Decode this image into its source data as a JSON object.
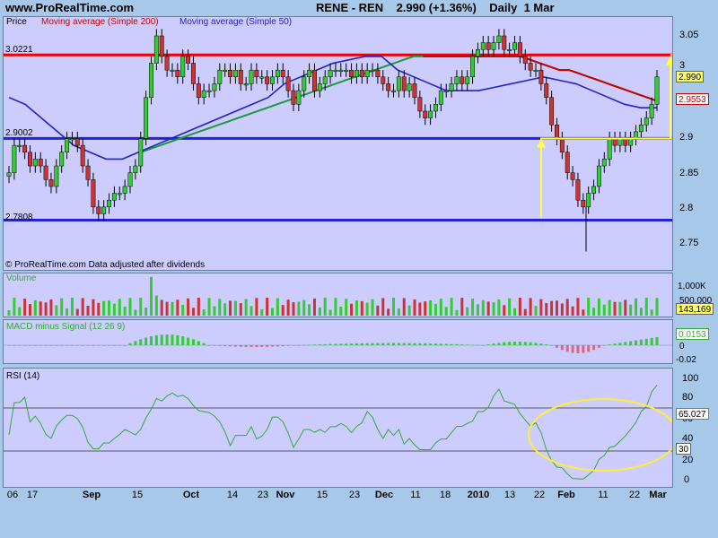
{
  "header": {
    "site": "www.ProRealTime.com",
    "ticker": "RENE - REN    2.990 (+1.36%)    Daily  1 Mar"
  },
  "price_panel": {
    "label_price": "Price",
    "label_ma200": "Moving average (Simple 200)",
    "label_ma50": "Moving average (Simple 50)",
    "footer": "© ProRealTime.com  Data adjusted after dividends",
    "level_labels": [
      "3.0221",
      "2.9002",
      "2.7808"
    ],
    "y_ticks": [
      "3.05",
      "3",
      "2.9",
      "2.85",
      "2.8",
      "2.75"
    ],
    "last_price": "2.990",
    "ma200_value": "2.9553"
  },
  "volume_panel": {
    "label": "Volume",
    "y_ticks": [
      "1,000K",
      "500,000"
    ],
    "last_value": "143,169"
  },
  "macd_panel": {
    "label": "MACD minus Signal (12 26 9)",
    "y_ticks": [
      "0",
      "-0.02"
    ],
    "last_value": "0.0153"
  },
  "rsi_panel": {
    "label": "RSI (14)",
    "y_ticks": [
      "100",
      "80",
      "60",
      "40",
      "20",
      "0"
    ],
    "last_value": "65.027",
    "lower_band_value": "30"
  },
  "x_axis": [
    "06",
    "17",
    "Sep",
    "15",
    "Oct",
    "14",
    "23",
    "Nov",
    "15",
    "23",
    "Dec",
    "11",
    "18",
    "2010",
    "13",
    "22",
    "Feb",
    "11",
    "22",
    "Mar"
  ],
  "colors": {
    "background": "#a8c8ea",
    "panel": "#ccccff",
    "up_candle": "#33cc33",
    "down_candle": "#cc3333",
    "ma200": "#cc0000",
    "ma50": "#2222cc",
    "resistance": "#ee0000",
    "support": "#2222dd",
    "annotation": "#ffff44"
  },
  "chart_data": {
    "type": "candlestick",
    "title": "RENE - REN 2.990 (+1.36%) Daily 1 Mar",
    "ylabel": "Price",
    "ylim": [
      2.71,
      3.07
    ],
    "horizontal_levels": [
      3.0221,
      2.9002,
      2.7808
    ],
    "last_close": 2.99,
    "ma200_last": 2.9553,
    "close": [
      2.85,
      2.89,
      2.89,
      2.88,
      2.86,
      2.87,
      2.86,
      2.84,
      2.83,
      2.86,
      2.88,
      2.9,
      2.9,
      2.89,
      2.86,
      2.84,
      2.8,
      2.79,
      2.8,
      2.81,
      2.82,
      2.82,
      2.83,
      2.85,
      2.86,
      2.9,
      2.96,
      3.01,
      3.05,
      3.02,
      3.0,
      3.0,
      2.99,
      3.02,
      3.01,
      2.98,
      2.96,
      2.97,
      2.97,
      2.98,
      3.0,
      3.0,
      2.99,
      3.0,
      2.98,
      2.98,
      3.0,
      2.99,
      2.99,
      2.98,
      2.99,
      3.0,
      2.99,
      2.97,
      2.95,
      2.97,
      2.99,
      3.0,
      2.97,
      2.98,
      2.99,
      3.0,
      3.0,
      3.0,
      3.0,
      2.99,
      3.0,
      2.99,
      3.0,
      3.0,
      2.99,
      2.98,
      2.97,
      2.97,
      2.99,
      2.97,
      2.98,
      2.96,
      2.94,
      2.93,
      2.94,
      2.95,
      2.97,
      2.97,
      2.98,
      2.99,
      2.98,
      2.99,
      3.02,
      3.03,
      3.04,
      3.03,
      3.04,
      3.05,
      3.03,
      3.03,
      3.04,
      3.02,
      3.01,
      3.0,
      3.0,
      2.98,
      2.96,
      2.92,
      2.9,
      2.88,
      2.85,
      2.84,
      2.81,
      2.8,
      2.82,
      2.83,
      2.86,
      2.87,
      2.9,
      2.89,
      2.9,
      2.89,
      2.9,
      2.91,
      2.92,
      2.93,
      2.95,
      2.99
    ],
    "ma200": [
      2.88,
      2.885,
      2.89,
      2.895,
      2.9,
      2.905,
      2.91,
      2.915,
      2.92,
      2.925,
      2.93,
      2.935,
      2.94,
      2.945,
      2.95,
      2.955,
      2.96,
      2.965,
      2.97,
      2.975,
      2.98,
      2.985,
      2.99,
      2.995,
      3.0,
      3.005,
      3.01,
      3.015,
      3.02,
      3.02,
      3.02,
      3.02,
      3.02,
      3.02,
      3.02,
      3.02,
      3.02,
      3.02,
      3.02,
      3.02,
      3.015,
      3.01,
      3.005,
      3.0,
      3.0,
      2.995,
      2.99,
      2.985,
      2.98,
      2.975,
      2.97,
      2.965,
      2.96,
      2.955
    ],
    "ma50": [
      2.96,
      2.95,
      2.93,
      2.91,
      2.89,
      2.88,
      2.87,
      2.87,
      2.88,
      2.89,
      2.9,
      2.91,
      2.92,
      2.93,
      2.94,
      2.95,
      2.96,
      2.98,
      2.99,
      3.0,
      3.01,
      3.015,
      3.02,
      3.02,
      3.0,
      2.99,
      2.98,
      2.97,
      2.97,
      2.97,
      2.975,
      2.98,
      2.985,
      2.99,
      2.985,
      2.98,
      2.97,
      2.96,
      2.95,
      2.945,
      2.945
    ]
  }
}
